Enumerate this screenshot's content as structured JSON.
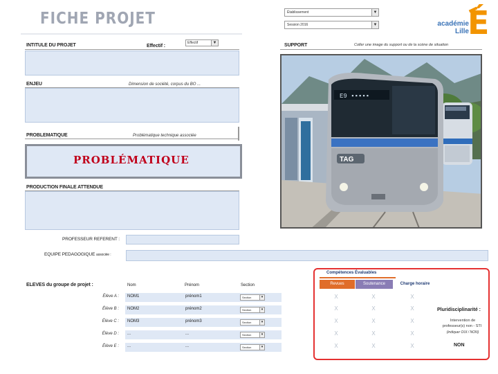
{
  "header": {
    "title": "FICHE PROJET",
    "dropdown1_value": "Établissement",
    "dropdown2_value": "Session 2016"
  },
  "logo": {
    "line1": "académie",
    "line2": "Lille",
    "letter": "É"
  },
  "form": {
    "intitule_label": "INTITULE DU PROJET",
    "effectif_label": "Effectif :",
    "effectif_value": "Effectif",
    "enjeu_label": "ENJEU",
    "enjeu_note": "Dimension de société, corpus du BO ...",
    "problematique_label": "PROBLEMATIQUE",
    "problematique_note": "Problématique technique associée",
    "problematique_overlay": "PROBLÉMATIQUE",
    "production_label": "PRODUCTION FINALE ATTENDUE",
    "professeur_label": "PROFESSEUR REFERENT :",
    "equipe_label": "EQUIPE PEDAGOGIQUE",
    "equipe_suffix": "associée :"
  },
  "support": {
    "label": "SUPPORT",
    "note": "Coller une image du support ou de la scène de situation"
  },
  "students": {
    "group_label": "ELEVES du groupe de projet :",
    "headers": [
      "Nom",
      "Prénom",
      "Section"
    ],
    "rows": [
      {
        "label": "Élève A :",
        "nom": "NOM1",
        "prenom": "prénom1",
        "section": "Section"
      },
      {
        "label": "Élève B :",
        "nom": "NOM2",
        "prenom": "prénom2",
        "section": "Section"
      },
      {
        "label": "Élève C :",
        "nom": "NOM3",
        "prenom": "prénom3",
        "section": "Section"
      },
      {
        "label": "Élève D :",
        "nom": "...",
        "prenom": "...",
        "section": "Section"
      },
      {
        "label": "Élève E :",
        "nom": "...",
        "prenom": "...",
        "section": "Section"
      }
    ]
  },
  "competences": {
    "title": "Compétences Évaluables",
    "tabs": [
      "Revues",
      "Soutenance",
      "Charge horaire"
    ],
    "mark": "X",
    "pluri_label": "Pluridisciplinarité :",
    "pluri_note1": "Intervention de",
    "pluri_note2": "professeur(s) non - STI",
    "pluri_note3": "(indiquer OUI / NON)",
    "pluri_value": "NON"
  },
  "colors": {
    "accent_red": "#c0001a",
    "box_blue": "#dfe8f5",
    "tab_orange": "#e06d2a",
    "tab_purple": "#8a7db5",
    "logo_orange": "#f29400",
    "logo_blue": "#3a73b7"
  }
}
